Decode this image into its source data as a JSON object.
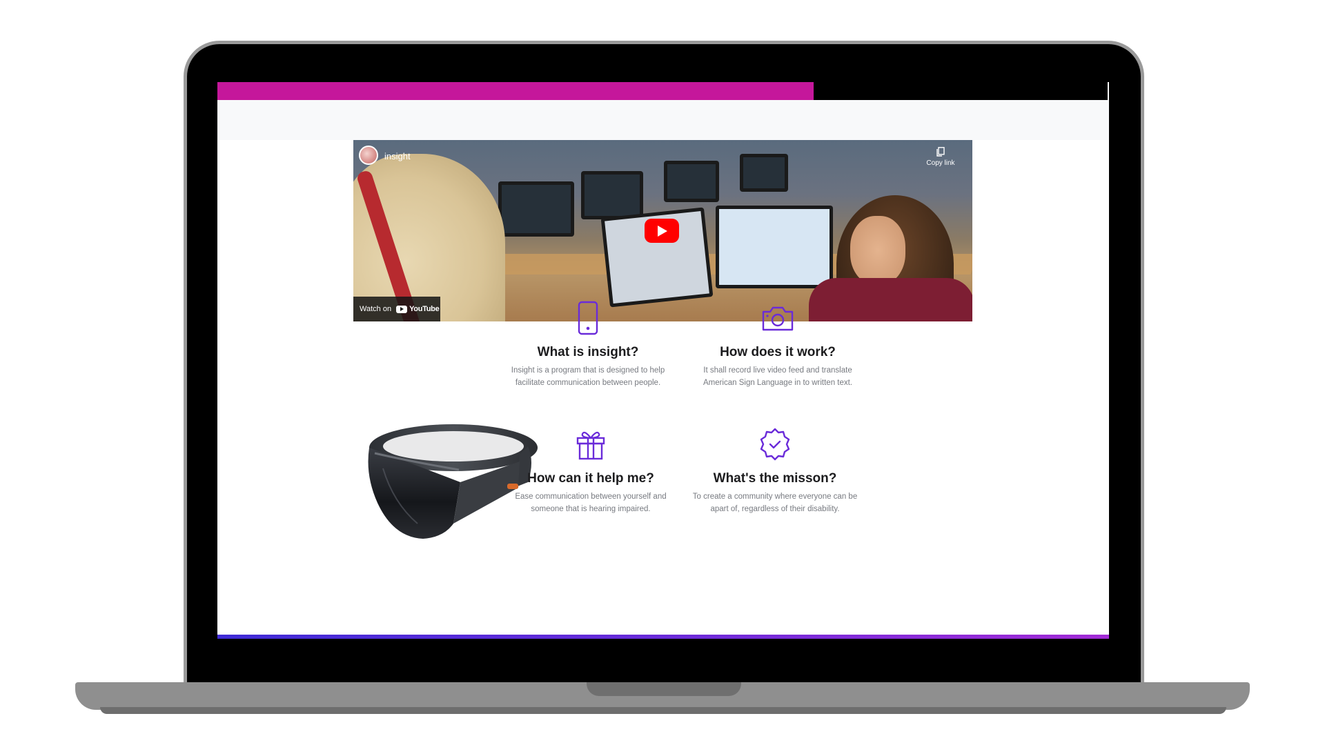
{
  "video": {
    "channel_name": "insight",
    "copy_link_label": "Copy link",
    "watch_on_label": "Watch on",
    "youtube_label": "YouTube"
  },
  "features": [
    {
      "icon": "smartphone-icon",
      "title": "What is insight?",
      "text": "Insight is a program that is designed to help facilitate communication between people."
    },
    {
      "icon": "camera-icon",
      "title": "How does it work?",
      "text": "It shall record live video feed and translate American Sign Language in to written text."
    },
    {
      "icon": "gift-icon",
      "title": "How can it help me?",
      "text": "Ease communication between yourself and someone that is hearing impaired."
    },
    {
      "icon": "badge-check-icon",
      "title": "What's the misson?",
      "text": "To create a community where everyone can be apart of, regardless of their disability."
    }
  ],
  "colors": {
    "accent_magenta": "#c5179b",
    "icon_purple": "#6a2bd9",
    "bottom_gradient_start": "#3f2bd6",
    "bottom_gradient_end": "#a22bd6",
    "youtube_red": "#ff0000"
  }
}
